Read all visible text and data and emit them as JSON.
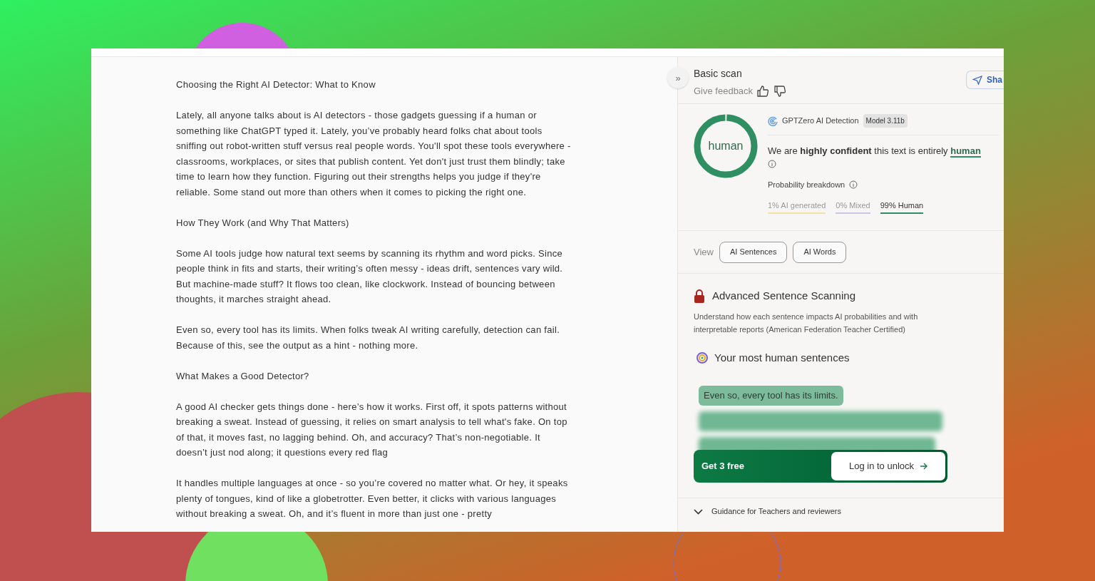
{
  "document": {
    "paragraphs": [
      {
        "text": "Choosing the Right AI Detector: What to Know"
      },
      {
        "text": "Lately, all anyone talks about is AI detectors - those gadgets guessing if a human or something like ChatGPT typed it. Lately, you’ve probably heard folks chat about tools sniffing out robot-written stuff versus real people words. You'll spot these tools everywhere - classrooms, workplaces, or sites that publish content. Yet don't just trust them blindly; take time to learn how they function. Figuring out their strengths helps you judge if they're reliable. Some stand out more than others when it comes to picking the right one."
      },
      {
        "text": "How They Work (and Why That Matters)"
      },
      {
        "text": "Some AI tools judge how natural text seems by scanning its rhythm and word picks. Since people think in fits and starts, their writing’s often messy - ideas drift, sentences vary wild. But machine-made stuff? It flows too clean, like clockwork. Instead of bouncing between thoughts, it marches straight ahead."
      },
      {
        "text": "Even so, every tool has its limits. When folks tweak AI writing carefully, detection can fail. Because of this, see the output as a hint - nothing more."
      },
      {
        "text": "What Makes a Good Detector?"
      },
      {
        "text": "A good AI checker gets things done - here’s how it works. First off, it spots patterns without breaking a sweat. Instead of guessing, it relies on smart analysis to tell what's fake. On top of that, it moves fast, no lagging behind. Oh, and accuracy? That’s non-negotiable. It doesn’t just nod along; it questions every red flag"
      },
      {
        "text": "It handles multiple languages at once - so you’re covered no matter what. Or hey, it speaks plenty of tongues, kind of like a globetrotter. Even better, it clicks with various languages without breaking a sweat. Oh, and it’s fluent in more than just one - pretty"
      }
    ]
  },
  "panel": {
    "collapse_glyph": "»",
    "title": "Basic scan",
    "feedback_label": "Give feedback",
    "share_button": "Sha",
    "result": {
      "verdict": "human",
      "level": 0.99,
      "detector": "GPTZero AI Detection",
      "model_badge": "Model 3.11b",
      "summary": "We are **highly confident** this text is entirely",
      "summary_result": "human",
      "breakdown_label": "Probability breakdown",
      "breakdown": [
        {
          "label": "1% AI generated",
          "color": "#f3e2a6"
        },
        {
          "label": "0% Mixed",
          "color": "#cbc5ea"
        },
        {
          "label": "99% Human",
          "color": "#2f8f62"
        }
      ]
    },
    "view": {
      "label": "View",
      "buttons": [
        "AI Sentences",
        "AI Words"
      ]
    },
    "advanced": {
      "title": "Advanced Sentence Scanning",
      "description": "Understand how each sentence impacts AI probabilities and with interpretable reports (American Federation Teacher Certified)"
    },
    "human_sentences": {
      "title": "Your most human sentences",
      "items": [
        {
          "text": "Even so, every tool has its limits.",
          "blurred": false
        },
        {
          "blurred": true
        },
        {
          "blurred": true
        }
      ]
    },
    "unlock": {
      "offer": "Get 3 free",
      "button": "Log in to unlock"
    },
    "guidance": {
      "label": "Guidance for Teachers and reviewers",
      "expanded": false
    }
  }
}
